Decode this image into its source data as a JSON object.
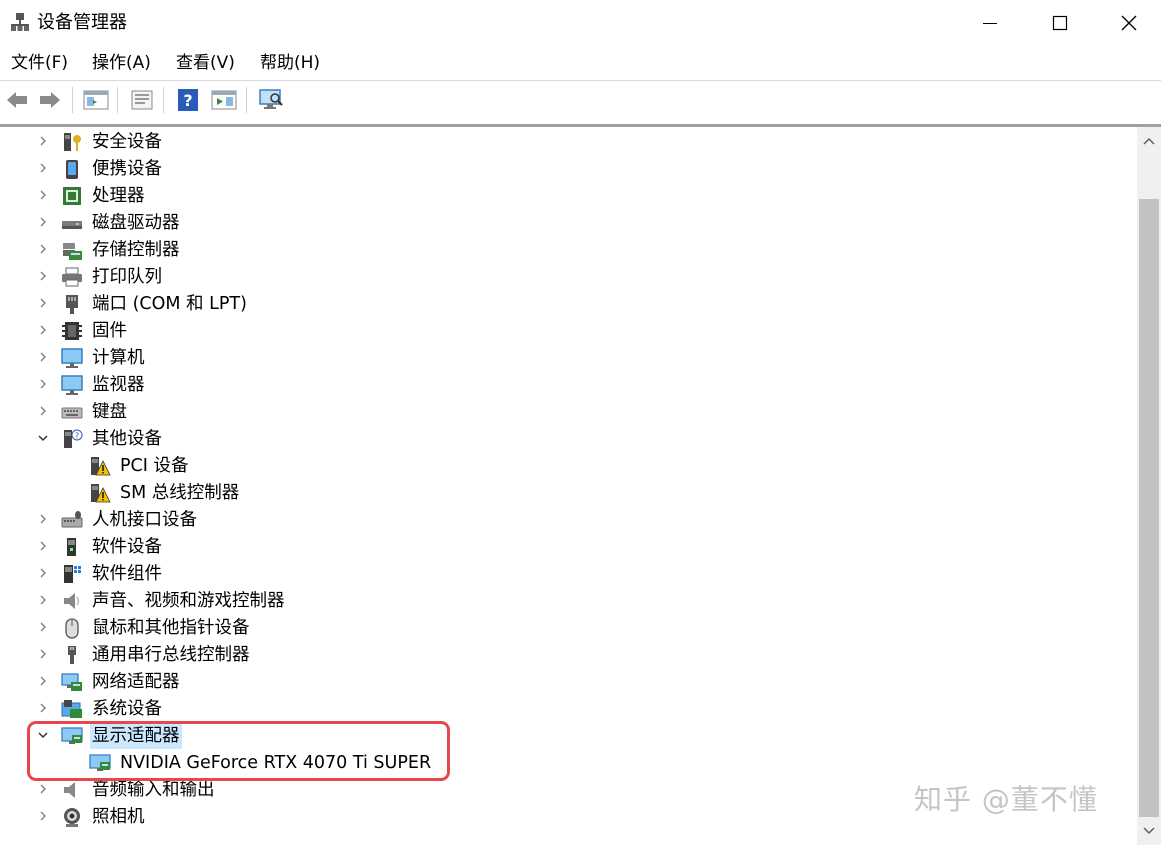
{
  "window": {
    "title": "设备管理器"
  },
  "menu": [
    "文件(F)",
    "操作(A)",
    "查看(V)",
    "帮助(H)"
  ],
  "toolbar": [
    "back-icon",
    "forward-icon",
    "properties-window-icon",
    "update-driver-icon",
    "help-icon",
    "run-icon",
    "scan-hardware-icon"
  ],
  "tree": [
    {
      "label": "安全设备",
      "icon": "security-device-icon",
      "expanded": false
    },
    {
      "label": "便携设备",
      "icon": "portable-device-icon",
      "expanded": false
    },
    {
      "label": "处理器",
      "icon": "processor-icon",
      "expanded": false
    },
    {
      "label": "磁盘驱动器",
      "icon": "disk-drive-icon",
      "expanded": false
    },
    {
      "label": "存储控制器",
      "icon": "storage-controller-icon",
      "expanded": false
    },
    {
      "label": "打印队列",
      "icon": "printer-icon",
      "expanded": false
    },
    {
      "label": "端口 (COM 和 LPT)",
      "icon": "port-icon",
      "expanded": false
    },
    {
      "label": "固件",
      "icon": "firmware-icon",
      "expanded": false
    },
    {
      "label": "计算机",
      "icon": "computer-icon",
      "expanded": false
    },
    {
      "label": "监视器",
      "icon": "monitor-icon",
      "expanded": false
    },
    {
      "label": "键盘",
      "icon": "keyboard-icon",
      "expanded": false
    },
    {
      "label": "其他设备",
      "icon": "other-device-icon",
      "expanded": true
    },
    {
      "label": "PCI 设备",
      "icon": "warning-device-icon",
      "child": true
    },
    {
      "label": "SM 总线控制器",
      "icon": "warning-device-icon",
      "child": true
    },
    {
      "label": "人机接口设备",
      "icon": "hid-icon",
      "expanded": false
    },
    {
      "label": "软件设备",
      "icon": "software-device-icon",
      "expanded": false
    },
    {
      "label": "软件组件",
      "icon": "software-component-icon",
      "expanded": false
    },
    {
      "label": "声音、视频和游戏控制器",
      "icon": "speaker-icon",
      "expanded": false
    },
    {
      "label": "鼠标和其他指针设备",
      "icon": "mouse-icon",
      "expanded": false
    },
    {
      "label": "通用串行总线控制器",
      "icon": "usb-icon",
      "expanded": false
    },
    {
      "label": "网络适配器",
      "icon": "network-adapter-icon",
      "expanded": false
    },
    {
      "label": "系统设备",
      "icon": "system-device-icon",
      "expanded": false
    },
    {
      "label": "显示适配器",
      "icon": "display-adapter-icon",
      "expanded": true,
      "selected": true
    },
    {
      "label": "NVIDIA GeForce RTX 4070 Ti SUPER",
      "icon": "display-adapter-icon",
      "child": true
    },
    {
      "label": "音频输入和输出",
      "icon": "audio-io-icon",
      "expanded": false
    },
    {
      "label": "照相机",
      "icon": "camera-icon",
      "expanded": false
    }
  ],
  "watermark": "知乎 @董不懂"
}
